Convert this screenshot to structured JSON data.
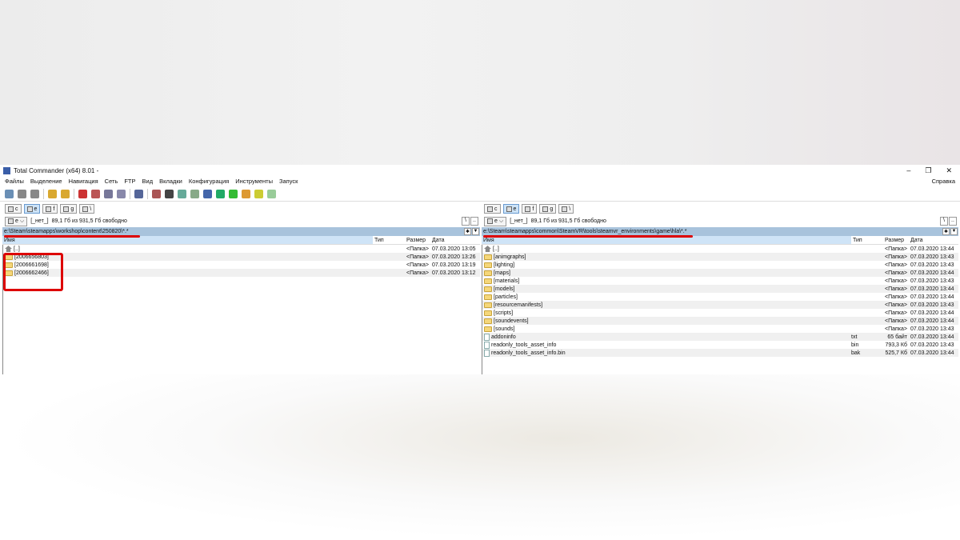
{
  "window": {
    "title": "Total Commander (x64) 8.01 -",
    "controls": [
      "–",
      "❐",
      "✕"
    ]
  },
  "menu": [
    "Файлы",
    "Выделение",
    "Навигация",
    "Сеть",
    "FTP",
    "Вид",
    "Вкладки",
    "Конфигурация",
    "Инструменты",
    "Запуск"
  ],
  "menu_help": "Справка",
  "drives": [
    "c",
    "e",
    "f",
    "g",
    "\\"
  ],
  "columns": {
    "name": "Имя",
    "type": "Тип",
    "size": "Размер",
    "date": "Дата"
  },
  "left": {
    "drive": "e",
    "label": "[_нет_]",
    "free": "89,1 Гб из 931,5 Гб свободно",
    "path": "e:\\Steam\\steamapps\\workshop\\content\\250820\\*.*",
    "rows": [
      {
        "icon": "up",
        "name": "[..]",
        "type": "",
        "size": "<Папка>",
        "date": "07.03.2020 13:05"
      },
      {
        "icon": "folder",
        "name": "[2006656803]",
        "type": "",
        "size": "<Папка>",
        "date": "07.03.2020 13:26"
      },
      {
        "icon": "folder",
        "name": "[2006661698]",
        "type": "",
        "size": "<Папка>",
        "date": "07.03.2020 13:19"
      },
      {
        "icon": "folder",
        "name": "[2006662466]",
        "type": "",
        "size": "<Папка>",
        "date": "07.03.2020 13:12"
      }
    ]
  },
  "right": {
    "drive": "e",
    "label": "[_нет_]",
    "free": "89,1 Гб из 931,5 Гб свободно",
    "path": "e:\\Steam\\steamapps\\common\\SteamVR\\tools\\steamvr_environments\\game\\hla\\*.*",
    "rows": [
      {
        "icon": "up",
        "name": "[..]",
        "type": "",
        "size": "<Папка>",
        "date": "07.03.2020 13:44"
      },
      {
        "icon": "folder",
        "name": "[animgraphs]",
        "type": "",
        "size": "<Папка>",
        "date": "07.03.2020 13:43"
      },
      {
        "icon": "folder",
        "name": "[lighting]",
        "type": "",
        "size": "<Папка>",
        "date": "07.03.2020 13:43"
      },
      {
        "icon": "folder",
        "name": "[maps]",
        "type": "",
        "size": "<Папка>",
        "date": "07.03.2020 13:44"
      },
      {
        "icon": "folder",
        "name": "[materials]",
        "type": "",
        "size": "<Папка>",
        "date": "07.03.2020 13:43"
      },
      {
        "icon": "folder",
        "name": "[models]",
        "type": "",
        "size": "<Папка>",
        "date": "07.03.2020 13:44"
      },
      {
        "icon": "folder",
        "name": "[particles]",
        "type": "",
        "size": "<Папка>",
        "date": "07.03.2020 13:44"
      },
      {
        "icon": "folder",
        "name": "[resourcemanifests]",
        "type": "",
        "size": "<Папка>",
        "date": "07.03.2020 13:43"
      },
      {
        "icon": "folder",
        "name": "[scripts]",
        "type": "",
        "size": "<Папка>",
        "date": "07.03.2020 13:44"
      },
      {
        "icon": "folder",
        "name": "[soundevents]",
        "type": "",
        "size": "<Папка>",
        "date": "07.03.2020 13:44"
      },
      {
        "icon": "folder",
        "name": "[sounds]",
        "type": "",
        "size": "<Папка>",
        "date": "07.03.2020 13:43"
      },
      {
        "icon": "file",
        "name": "addoninfo",
        "type": "txt",
        "size": "65 байт",
        "date": "07.03.2020 13:44"
      },
      {
        "icon": "file",
        "name": "readonly_tools_asset_info",
        "type": "bin",
        "size": "793,3 Кб",
        "date": "07.03.2020 13:43"
      },
      {
        "icon": "file",
        "name": "readonly_tools_asset_info.bin",
        "type": "bak",
        "size": "525,7 Кб",
        "date": "07.03.2020 13:44"
      }
    ]
  },
  "colors": {
    "highlight": "#d00000",
    "path_bar": "#a8c3dc"
  }
}
